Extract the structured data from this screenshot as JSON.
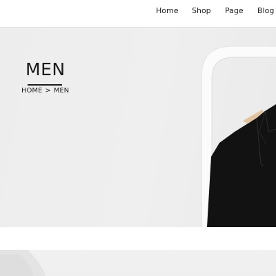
{
  "nav": {
    "items": [
      {
        "label": "Home"
      },
      {
        "label": "Shop"
      },
      {
        "label": "Page"
      },
      {
        "label": "Blog"
      }
    ]
  },
  "hero": {
    "title": "MEN",
    "breadcrumb": {
      "home": "HOME",
      "separator": ">",
      "current": "MEN"
    },
    "image": "black-shirt-on-white-clothing-rack"
  },
  "colors": {
    "text": "#222222",
    "hero_background": "#eeeeee",
    "garment": "#111111",
    "rack": "#ffffff",
    "hanger": "#e2c39f"
  }
}
